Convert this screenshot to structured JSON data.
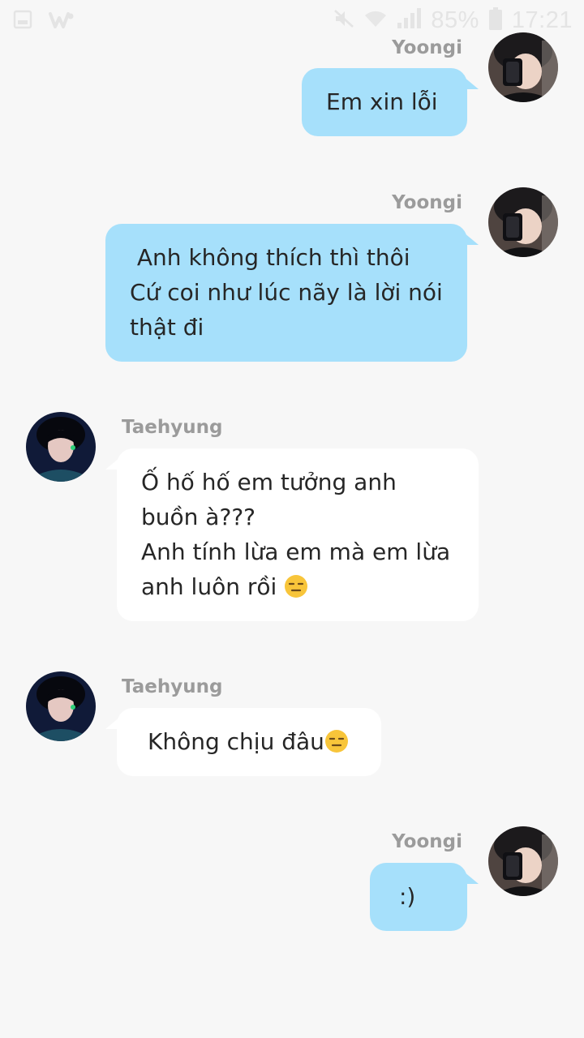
{
  "status_bar": {
    "battery_percent": "85%",
    "time": "17:21",
    "icons": [
      "image-icon",
      "wattpad-icon",
      "mute-icon",
      "wifi-icon",
      "signal-icon",
      "battery-icon"
    ]
  },
  "colors": {
    "background": "#f7f7f7",
    "outgoing_bubble": "#a6e0fb",
    "incoming_bubble": "#ffffff",
    "name_text": "#9b9b9b",
    "message_text": "#262626"
  },
  "messages": [
    {
      "sender": "Yoongi",
      "direction": "outgoing",
      "text": "Em xin lỗi"
    },
    {
      "sender": "Yoongi",
      "direction": "outgoing",
      "text": " Anh không thích thì thôi\nCứ coi như lúc nãy là lời nói\nthật đi"
    },
    {
      "sender": "Taehyung",
      "direction": "incoming",
      "text": "Ố hố hố em tưởng anh\nbuồn à???\nAnh tính lừa em mà em lừa\nanh luôn rồi ",
      "emoji": "expressionless-face-emoji"
    },
    {
      "sender": "Taehyung",
      "direction": "incoming",
      "text": "Không chịu đâu",
      "emoji": "expressionless-face-emoji"
    },
    {
      "sender": "Yoongi",
      "direction": "outgoing",
      "text": ":)"
    }
  ]
}
